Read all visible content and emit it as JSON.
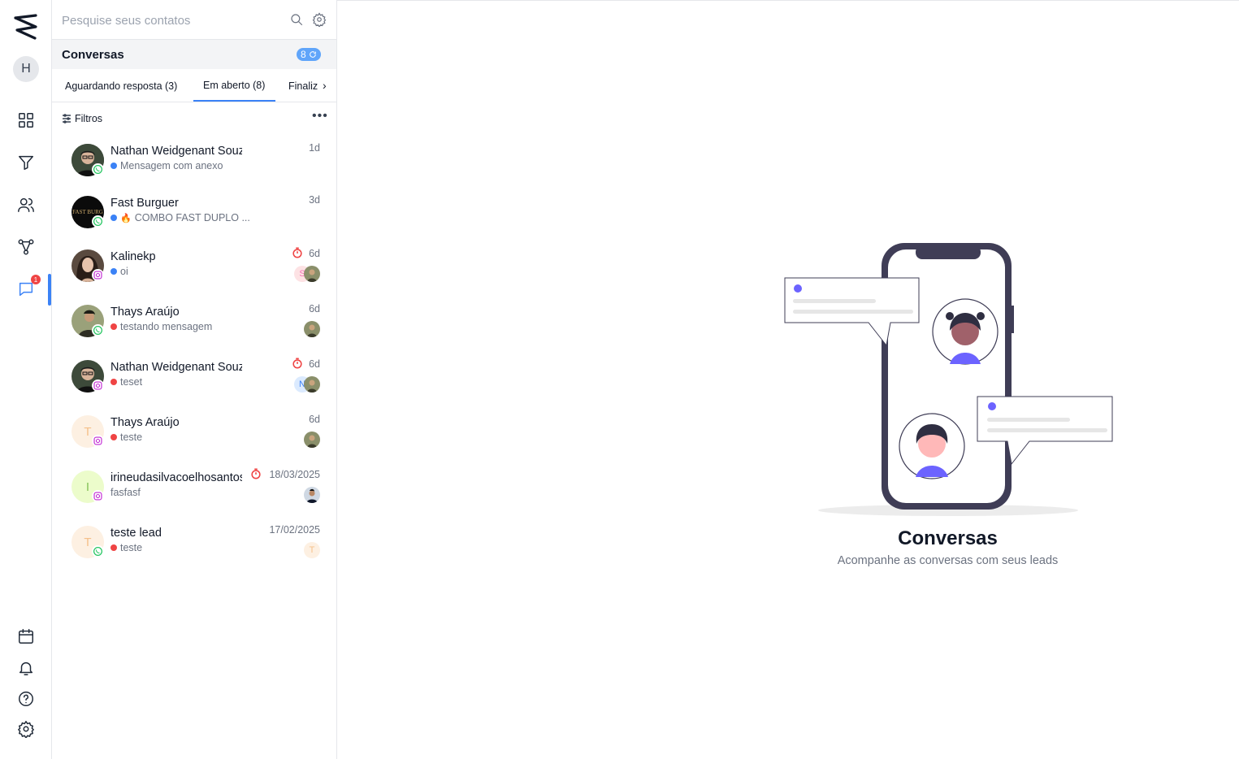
{
  "rail": {
    "user_initial": "H",
    "notification_count": "1"
  },
  "search": {
    "placeholder": "Pesquise seus contatos"
  },
  "conversations": {
    "title": "Conversas",
    "count": "8"
  },
  "tabs": [
    {
      "label": "Aguardando resposta (3)"
    },
    {
      "label": "Em aberto (8)"
    },
    {
      "label": "Finaliz"
    }
  ],
  "filters_label": "Filtros",
  "items": [
    {
      "name": "Nathan Weidgenant Souza",
      "preview": "Mensagem com anexo",
      "time": "1d",
      "channel": "whatsapp",
      "dot": "#3b82f6"
    },
    {
      "name": "Fast Burguer",
      "preview": "COMBO FAST DUPLO ...",
      "emoji": "🔥",
      "time": "3d",
      "channel": "whatsapp",
      "dot": "#3b82f6",
      "avatar_text": "FAST BURG"
    },
    {
      "name": "Kalinekp",
      "preview": "oi",
      "time": "6d",
      "channel": "instagram",
      "dot": "#3b82f6",
      "assignee_initial": "S"
    },
    {
      "name": "Thays Araújo",
      "preview": "testando mensagem",
      "time": "6d",
      "channel": "whatsapp",
      "dot": "#ef4444"
    },
    {
      "name": "Nathan Weidgenant Souza",
      "preview": "teset",
      "time": "6d",
      "channel": "instagram",
      "dot": "#ef4444",
      "assignee_initial": "N"
    },
    {
      "name": "Thays Araújo",
      "preview": "teste",
      "time": "6d",
      "channel": "instagram",
      "dot": "#ef4444",
      "initial": "T"
    },
    {
      "name": "irineudasilvacoelhosantos",
      "preview": "fasfasf",
      "time": "18/03/2025",
      "channel": "instagram",
      "initial": "I"
    },
    {
      "name": "teste lead",
      "preview": "teste",
      "time": "17/02/2025",
      "channel": "whatsapp",
      "dot": "#ef4444",
      "initial": "T",
      "assignee_initial": "T"
    }
  ],
  "empty_state": {
    "title": "Conversas",
    "subtitle": "Acompanhe as conversas com seus leads"
  },
  "colors": {
    "accent": "#3b82f6",
    "illustration_purple": "#6c63ff",
    "phone_frame": "#3f3d56"
  }
}
